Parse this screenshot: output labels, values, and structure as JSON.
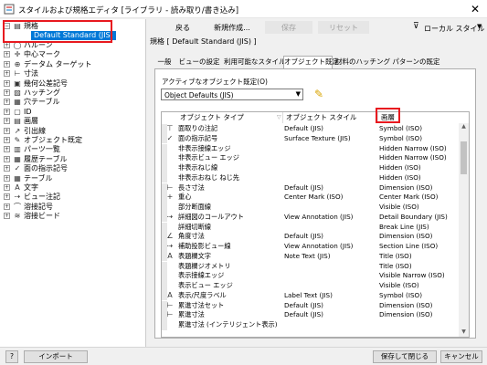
{
  "window": {
    "title": "スタイルおよび規格エディタ [ライブラリ - 読み取り/書き込み]",
    "close_label": "✕"
  },
  "tree": {
    "root_label": "規格",
    "selected_child": "Default Standard (JIS)",
    "items": [
      {
        "label": "バルーン",
        "icon": "balloon-icon",
        "glyph": "◯"
      },
      {
        "label": "中心マーク",
        "icon": "center-mark-icon",
        "glyph": "✛"
      },
      {
        "label": "データム ターゲット",
        "icon": "datum-target-icon",
        "glyph": "⊕"
      },
      {
        "label": "寸法",
        "icon": "dimension-icon",
        "glyph": "⊢"
      },
      {
        "label": "幾何公差記号",
        "icon": "feature-control-icon",
        "glyph": "▣"
      },
      {
        "label": "ハッチング",
        "icon": "hatch-icon",
        "glyph": "▨"
      },
      {
        "label": "穴テーブル",
        "icon": "hole-table-icon",
        "glyph": "▦"
      },
      {
        "label": "ID",
        "icon": "id-icon",
        "glyph": "▢"
      },
      {
        "label": "画層",
        "icon": "layer-icon",
        "glyph": "▤"
      },
      {
        "label": "引出線",
        "icon": "leader-icon",
        "glyph": "↗"
      },
      {
        "label": "オブジェクト既定",
        "icon": "object-defaults-icon",
        "glyph": "✎"
      },
      {
        "label": "パーツ一覧",
        "icon": "parts-list-icon",
        "glyph": "▥"
      },
      {
        "label": "履歴テーブル",
        "icon": "revision-table-icon",
        "glyph": "▦"
      },
      {
        "label": "面の指示記号",
        "icon": "surface-texture-icon",
        "glyph": "✓"
      },
      {
        "label": "テーブル",
        "icon": "table-icon",
        "glyph": "▦"
      },
      {
        "label": "文字",
        "icon": "text-icon",
        "glyph": "A"
      },
      {
        "label": "ビュー注記",
        "icon": "view-annotation-icon",
        "glyph": "⇢"
      },
      {
        "label": "溶接記号",
        "icon": "weld-symbol-icon",
        "glyph": "⌒"
      },
      {
        "label": "溶接ビード",
        "icon": "weld-bead-icon",
        "glyph": "≋"
      }
    ]
  },
  "toolbar": {
    "back": "戻る",
    "new": "新規作成...",
    "save": "保存",
    "reset": "リセット",
    "filter": "ローカル スタイル",
    "filter_caret": "▼",
    "filter_icon": "⊽"
  },
  "standard_header": "規格 [ Default Standard (JIS) ]",
  "tabs": [
    "一般",
    "ビューの設定",
    "利用可能なスタイル",
    "オブジェクト既定",
    "材料のハッチング パターンの既定"
  ],
  "active_tab_index": 3,
  "active_defaults_label": "アクティブなオブジェクト既定(O)",
  "active_defaults_value": "Object Defaults (JIS)",
  "table": {
    "headers": {
      "type": "オブジェクト タイプ",
      "style": "オブジェクト スタイル",
      "layer": "画層"
    },
    "rows": [
      {
        "icon": "chamfer-note-icon",
        "glyph": "⊤",
        "type": "面取りの注記",
        "style": "Default (JIS)",
        "layer": "Symbol (ISO)"
      },
      {
        "icon": "surface-texture-icon",
        "glyph": "✓",
        "type": "面の指示記号",
        "style": "Surface Texture (JIS)",
        "layer": "Symbol (ISO)"
      },
      {
        "icon": "",
        "glyph": "",
        "type": "非表示接線エッジ",
        "style": "",
        "layer": "Hidden Narrow (ISO)"
      },
      {
        "icon": "",
        "glyph": "",
        "type": "非表示ビュー エッジ",
        "style": "",
        "layer": "Hidden Narrow (ISO)"
      },
      {
        "icon": "",
        "glyph": "",
        "type": "非表示ねじ線",
        "style": "",
        "layer": "Hidden (ISO)"
      },
      {
        "icon": "",
        "glyph": "",
        "type": "非表示おねじ ねじ先",
        "style": "",
        "layer": "Hidden (ISO)"
      },
      {
        "icon": "linear-dimension-icon",
        "glyph": "⊢",
        "type": "長さ寸法",
        "style": "Default (JIS)",
        "layer": "Dimension (ISO)"
      },
      {
        "icon": "centroid-icon",
        "glyph": "+",
        "type": "重心",
        "style": "Center Mark (ISO)",
        "layer": "Center Mark (ISO)"
      },
      {
        "icon": "",
        "glyph": "",
        "type": "部分断面線",
        "style": "",
        "layer": "Visible (ISO)"
      },
      {
        "icon": "detail-view-icon",
        "glyph": "⇢",
        "type": "詳細図のコールアウト",
        "style": "View Annotation (JIS)",
        "layer": "Detail Boundary (JIS)"
      },
      {
        "icon": "",
        "glyph": "",
        "type": "詳細切断線",
        "style": "",
        "layer": "Break Line (JIS)"
      },
      {
        "icon": "angular-dimension-icon",
        "glyph": "∠",
        "type": "角度寸法",
        "style": "Default (JIS)",
        "layer": "Dimension (ISO)"
      },
      {
        "icon": "auxiliary-view-icon",
        "glyph": "⇢",
        "type": "補助投影ビュー線",
        "style": "View Annotation (JIS)",
        "layer": "Section Line (ISO)"
      },
      {
        "icon": "title-text-icon",
        "glyph": "A",
        "type": "表題欄文字",
        "style": "Note Text (JIS)",
        "layer": "Title (ISO)"
      },
      {
        "icon": "",
        "glyph": "",
        "type": "表題欄ジオメトリ",
        "style": "",
        "layer": "Title (ISO)"
      },
      {
        "icon": "",
        "glyph": "",
        "type": "表示接線エッジ",
        "style": "",
        "layer": "Visible Narrow (ISO)"
      },
      {
        "icon": "",
        "glyph": "",
        "type": "表示ビュー エッジ",
        "style": "",
        "layer": "Visible (ISO)"
      },
      {
        "icon": "display-label-icon",
        "glyph": "A",
        "type": "表示/尺度ラベル",
        "style": "Label Text (JIS)",
        "layer": "Symbol (ISO)"
      },
      {
        "icon": "baseline-dimension-icon",
        "glyph": "⊢",
        "type": "累進寸法セット",
        "style": "Default (JIS)",
        "layer": "Dimension (ISO)"
      },
      {
        "icon": "ordinate-dimension-icon",
        "glyph": "⊢",
        "type": "累進寸法",
        "style": "Default (JIS)",
        "layer": "Dimension (ISO)"
      },
      {
        "icon": "",
        "glyph": "",
        "type": "累進寸法 (インテリジェント表示)",
        "style": "",
        "layer": ""
      }
    ]
  },
  "bottom": {
    "help": "?",
    "import": "インポート",
    "save_close": "保存して閉じる",
    "cancel": "キャンセル"
  },
  "colors": {
    "selection": "#0078d7",
    "highlight_box": "#e8191f",
    "pencil": "#d9a400"
  }
}
